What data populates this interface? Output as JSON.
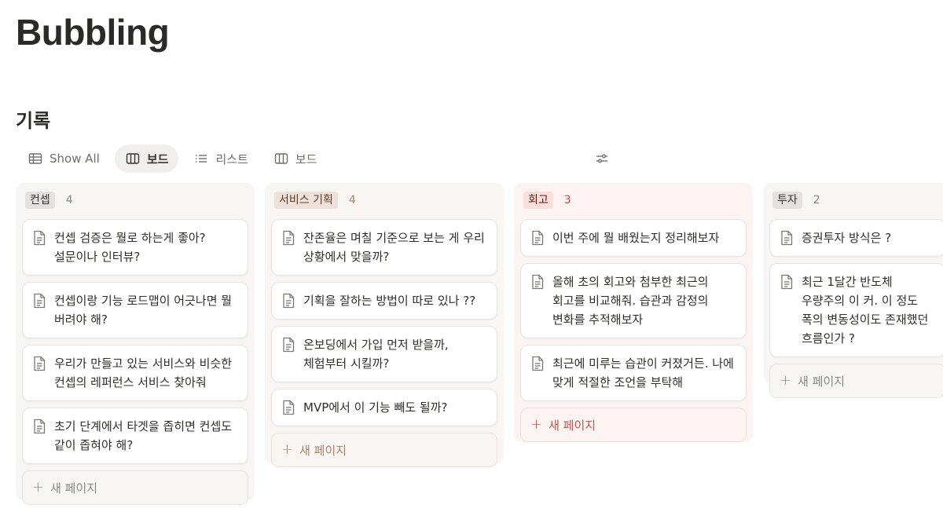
{
  "page": {
    "title": "Bubbling"
  },
  "section": {
    "title": "기록"
  },
  "views": [
    {
      "label": "Show All",
      "icon": "table-icon",
      "active": false
    },
    {
      "label": "보드",
      "icon": "board-icon",
      "active": true
    },
    {
      "label": "리스트",
      "icon": "list-icon",
      "active": false
    },
    {
      "label": "보드",
      "icon": "board-icon",
      "active": false
    }
  ],
  "toolbar": {
    "filter_icon": "sliders-icon"
  },
  "columns": [
    {
      "tag": "컨셉",
      "count": "4",
      "colors": {
        "bg": "#f7f6f5",
        "tag_bg": "#e3e2e0",
        "tag_text": "#37352f",
        "count": "#8a8884",
        "new": "#8a8884",
        "new_bg": "#f7f6f5",
        "new_border": "#e6e4e0"
      },
      "cards": [
        {
          "title": "컨셉 검증은 뭘로 하는게 좋아? 설문이나 인터뷰?"
        },
        {
          "title": "컨셉이랑 기능 로드맵이 어긋나면 뭘 버려야 해?"
        },
        {
          "title": "우리가 만들고 있는 서비스와 비슷한 컨셉의 레퍼런스 서비스 찾아줘"
        },
        {
          "title": "초기 단계에서 타겟을 좁히면 컨셉도 같이 좁혀야 해?"
        }
      ],
      "new_page": "새 페이지"
    },
    {
      "tag": "서비스 기획",
      "count": "4",
      "colors": {
        "bg": "#f9f5f3",
        "tag_bg": "#eee0da",
        "tag_text": "#5c3b2d",
        "count": "#a7836f",
        "new": "#a7836f",
        "new_bg": "#f9f5f3",
        "new_border": "#ece4df"
      },
      "cards": [
        {
          "title": "잔존율은 며칠 기준으로 보는 게 우리 상황에서 맞을까?"
        },
        {
          "title": "기획을 잘하는 방법이 따로 있나 ??"
        },
        {
          "title": "온보딩에서 가입 먼저 받을까, 체험부터 시킬까?"
        },
        {
          "title": "MVP에서 이 기능 빼도 될까?"
        }
      ],
      "new_page": "새 페이지"
    },
    {
      "tag": "회고",
      "count": "3",
      "colors": {
        "bg": "#fbf4f3",
        "tag_bg": "#fbdfdb",
        "tag_text": "#5d1715",
        "count": "#c4554d",
        "new": "#c4554d",
        "new_bg": "#fbf4f3",
        "new_border": "#f1dfdc"
      },
      "cards": [
        {
          "title": "이번 주에 뭘 배웠는지 정리해보자"
        },
        {
          "title": "올해 초의 회고와 첨부한 최근의 회고를 비교해줘. 습관과 감정의 변화를 추적해보자"
        },
        {
          "title": "최근에 미루는 습관이 커졌거든. 나에 맞게 적절한 조언을 부탁해"
        }
      ],
      "new_page": "새 페이지"
    },
    {
      "tag": "투자",
      "count": "2",
      "colors": {
        "bg": "#f7f6f5",
        "tag_bg": "#e3e2e0",
        "tag_text": "#37352f",
        "count": "#8a8884",
        "new": "#8a8884",
        "new_bg": "#f7f6f5",
        "new_border": "#e6e4e0"
      },
      "cards": [
        {
          "title": "증권투자 방식은 ?"
        },
        {
          "title": "최근 1달간 반도체 우량주의 이 커. 이 정도 폭의 변동성이도 존재했던 흐름인가 ?"
        }
      ],
      "new_page": "새 페이지"
    }
  ]
}
